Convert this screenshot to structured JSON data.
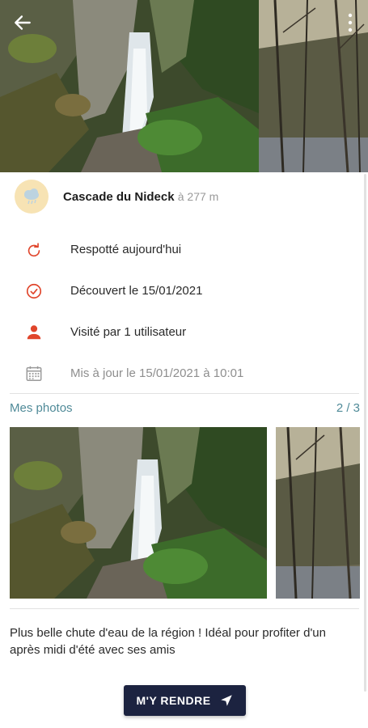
{
  "header": {
    "back_icon": "arrow-left-icon",
    "more_icon": "more-vertical-icon"
  },
  "place": {
    "name": "Cascade du Nideck",
    "distance": "à 277 m",
    "avatar_icon": "cloud-icon"
  },
  "info": {
    "respotted": "Respotté aujourd'hui",
    "discovered": "Découvert le 15/01/2021",
    "visited": "Visité par 1 utilisateur",
    "updated": "Mis à jour le 15/01/2021 à 10:01"
  },
  "colors": {
    "accent": "#e0452b",
    "muted_icon": "#9a9a9a",
    "link": "#4f8a98",
    "button_bg": "#1c2340",
    "avatar_bg": "#f7e3b4"
  },
  "photos": {
    "label": "Mes photos",
    "counter": "2 / 3"
  },
  "description": "Plus belle chute d'eau de la région ! Idéal pour profiter d'un après midi d'été avec ses amis",
  "action": {
    "label": "M'Y RENDRE",
    "icon": "navigation-arrow-icon"
  }
}
